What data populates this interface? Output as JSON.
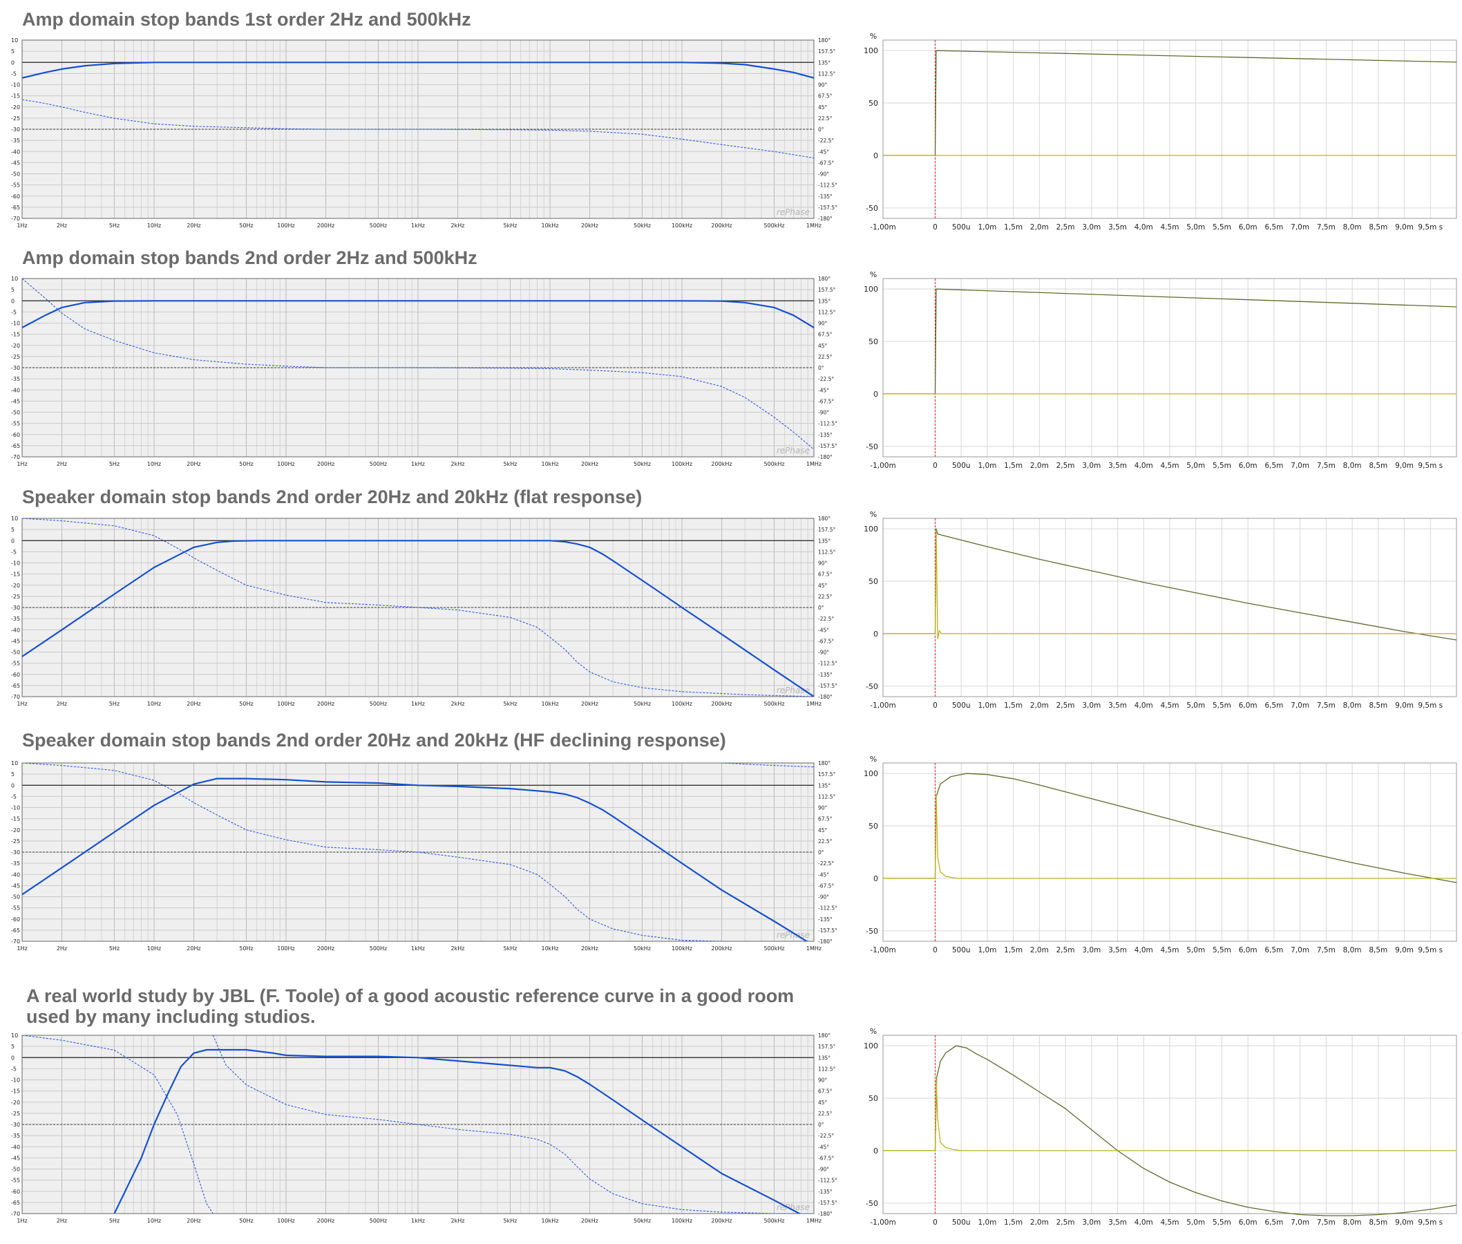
{
  "freq_axis": {
    "tick_labels": [
      "1Hz",
      "2Hz",
      "5Hz",
      "10Hz",
      "20Hz",
      "50Hz",
      "100Hz",
      "200Hz",
      "500Hz",
      "1kHz",
      "2kHz",
      "5kHz",
      "10kHz",
      "20kHz",
      "50kHz",
      "100kHz",
      "200kHz",
      "500kHz",
      "1MHz"
    ],
    "tick_values": [
      1,
      2,
      5,
      10,
      20,
      50,
      100,
      200,
      500,
      1000,
      2000,
      5000,
      10000,
      20000,
      50000,
      100000,
      200000,
      500000,
      1000000
    ],
    "xlim": [
      1,
      1000000
    ],
    "y_ticks": [
      "10",
      "5",
      "0",
      "-5",
      "-10",
      "-15",
      "-20",
      "-25",
      "-30",
      "-35",
      "-40",
      "-45",
      "-50",
      "-55",
      "-60",
      "-65",
      "-70"
    ],
    "phase_ticks": [
      "180°",
      "157.5°",
      "135°",
      "112.5°",
      "90°",
      "67.5°",
      "45°",
      "22.5°",
      "0°",
      "-22.5°",
      "-45°",
      "-67.5°",
      "-90°",
      "-112.5°",
      "-135°",
      "-157.5°",
      "-180°"
    ],
    "ylim": [
      -70,
      10
    ],
    "phase_lim": [
      -180,
      180
    ],
    "watermark": "rePhase"
  },
  "time_axis": {
    "tick_labels": [
      "-1,00m",
      "0",
      "500u",
      "1,0m",
      "1,5m",
      "2,0m",
      "2,5m",
      "3,0m",
      "3,5m",
      "4,0m",
      "4,5m",
      "5,0m",
      "5,5m",
      "6,0m",
      "6,5m",
      "7,0m",
      "7,5m",
      "8,0m",
      "8,5m",
      "9,0m",
      "9,5m s"
    ],
    "tick_values": [
      -1.0,
      0,
      0.5,
      1.0,
      1.5,
      2.0,
      2.5,
      3.0,
      3.5,
      4.0,
      4.5,
      5.0,
      5.5,
      6.0,
      6.5,
      7.0,
      7.5,
      8.0,
      8.5,
      9.0,
      9.5
    ],
    "xlim": [
      -1.0,
      10.0
    ],
    "y_ticks": [
      "100",
      "50",
      "0",
      "-50"
    ],
    "y_values": [
      100,
      50,
      0,
      -50
    ],
    "ylim": [
      -60,
      110
    ],
    "y_unit": "%"
  },
  "colors": {
    "magnitude": "#1550d0",
    "phase": "#2a5ad8",
    "step": "#5e6a2c",
    "impulse": "#bfb21a",
    "marker": "#dd2222"
  },
  "chart_data": [
    {
      "id": "p1",
      "type": "line",
      "title": "Amp domain stop bands 1st order 2Hz and 500kHz",
      "series": [
        {
          "name": "",
          "style": "magnitude",
          "x": [
            1,
            1.5,
            2,
            3,
            5,
            10,
            100,
            1000,
            10000,
            100000,
            200000,
            300000,
            500000,
            700000,
            1000000
          ],
          "y": [
            -7,
            -4.5,
            -3,
            -1.5,
            -0.5,
            0,
            0,
            0,
            0,
            0,
            -0.4,
            -1,
            -3,
            -4.5,
            -7
          ]
        },
        {
          "name": "",
          "style": "phase",
          "x": [
            1,
            1.5,
            2,
            3,
            5,
            10,
            20,
            50,
            100,
            200,
            1000,
            5000,
            10000,
            20000,
            50000,
            100000,
            200000,
            500000,
            1000000
          ],
          "y": [
            60,
            52,
            45,
            34,
            22,
            11,
            6,
            3,
            1,
            0,
            0,
            -1,
            -2,
            -4,
            -10,
            -20,
            -31,
            -45,
            -58
          ]
        }
      ]
    },
    {
      "id": "p2",
      "type": "line",
      "title": "Amp domain stop bands 2nd order 2Hz and 500kHz",
      "series": [
        {
          "name": "",
          "style": "magnitude",
          "x": [
            1,
            1.5,
            2,
            3,
            5,
            10,
            100,
            10000,
            100000,
            200000,
            300000,
            500000,
            700000,
            1000000
          ],
          "y": [
            -12,
            -6.5,
            -3,
            -0.8,
            -0.1,
            0,
            0,
            0,
            0,
            -0.1,
            -0.8,
            -3,
            -6.5,
            -12
          ]
        },
        {
          "name": "",
          "style": "phase",
          "x": [
            1,
            1.5,
            2,
            3,
            5,
            10,
            20,
            50,
            100,
            200,
            1000,
            5000,
            10000,
            20000,
            50000,
            100000,
            200000,
            300000,
            500000,
            700000,
            1000000
          ],
          "y": [
            180,
            140,
            110,
            78,
            55,
            30,
            16,
            7,
            3,
            0,
            0,
            -1,
            -2,
            -5,
            -10,
            -18,
            -38,
            -60,
            -100,
            -130,
            -165
          ]
        }
      ]
    },
    {
      "id": "p3",
      "type": "line",
      "title": "Speaker domain stop bands 2nd order 20Hz and 20kHz (flat response)",
      "series": [
        {
          "name": "",
          "style": "magnitude",
          "x": [
            1,
            2,
            5,
            10,
            20,
            30,
            40,
            60,
            100,
            1000,
            10000,
            13000,
            16000,
            20000,
            25000,
            30000,
            40000,
            60000,
            100000,
            200000,
            500000,
            1000000
          ],
          "y": [
            -52,
            -40,
            -24,
            -12,
            -3,
            -0.8,
            -0.2,
            0,
            0,
            0,
            0,
            -0.5,
            -1.5,
            -3,
            -6,
            -9,
            -14,
            -21,
            -30,
            -42,
            -58,
            -70
          ]
        },
        {
          "name": "",
          "style": "phase",
          "x": [
            1,
            2,
            5,
            10,
            15,
            20,
            30,
            50,
            100,
            200,
            500,
            1000,
            2000,
            5000,
            8000,
            10000,
            13000,
            16000,
            20000,
            30000,
            50000,
            100000,
            300000,
            1000000
          ],
          "y": [
            180,
            175,
            165,
            145,
            120,
            100,
            75,
            45,
            25,
            10,
            5,
            0,
            -5,
            -20,
            -40,
            -60,
            -85,
            -110,
            -130,
            -150,
            -162,
            -170,
            -176,
            -180
          ]
        }
      ]
    },
    {
      "id": "p4",
      "type": "line",
      "title": "Speaker domain stop bands 2nd order 20Hz and 20kHz (HF declining response)",
      "series": [
        {
          "name": "",
          "style": "magnitude",
          "x": [
            1,
            2,
            5,
            10,
            20,
            30,
            50,
            100,
            200,
            500,
            1000,
            2000,
            5000,
            10000,
            13000,
            16000,
            20000,
            25000,
            30000,
            40000,
            60000,
            100000,
            200000,
            500000,
            1000000
          ],
          "y": [
            -49,
            -37,
            -21,
            -9,
            0.5,
            3,
            3,
            2.5,
            1.5,
            1,
            0,
            -0.5,
            -1.5,
            -3,
            -4,
            -5.5,
            -8,
            -11,
            -14,
            -19,
            -26,
            -35,
            -47,
            -61,
            -72
          ]
        },
        {
          "name": "",
          "style": "phase",
          "x": [
            1,
            2,
            5,
            10,
            15,
            20,
            30,
            50,
            100,
            200,
            500,
            1000,
            2000,
            5000,
            8000,
            10000,
            13000,
            16000,
            20000,
            30000,
            50000,
            100000,
            200000
          ],
          "y": [
            180,
            175,
            165,
            145,
            120,
            100,
            75,
            45,
            25,
            10,
            5,
            0,
            -10,
            -25,
            -45,
            -65,
            -90,
            -115,
            -135,
            -155,
            -168,
            -178,
            -180
          ]
        },
        {
          "name": "",
          "style": "phase",
          "x": [
            200000,
            500000,
            1000000
          ],
          "y": [
            180,
            175,
            172
          ]
        }
      ]
    },
    {
      "id": "p5",
      "type": "line",
      "title": "A real world study by JBL (F. Toole) of a good acoustic reference curve in a good room\nused by many including studios.",
      "series": [
        {
          "name": "",
          "style": "magnitude",
          "x": [
            5,
            8,
            10,
            13,
            16,
            20,
            25,
            30,
            50,
            80,
            100,
            200,
            500,
            1000,
            2000,
            5000,
            8000,
            10000,
            13000,
            16000,
            20000,
            30000,
            50000,
            100000,
            200000,
            500000,
            900000
          ],
          "y": [
            -70,
            -45,
            -30,
            -15,
            -4,
            2,
            3.5,
            3.5,
            3.5,
            2,
            1,
            0.5,
            0.5,
            0,
            -1.5,
            -3.5,
            -4.5,
            -4.5,
            -6,
            -8.5,
            -12,
            -19,
            -28,
            -40,
            -52,
            -64,
            -72
          ]
        },
        {
          "name": "",
          "style": "phase",
          "x": [
            1,
            2,
            5,
            10,
            15,
            20,
            25,
            28
          ],
          "y": [
            180,
            170,
            150,
            100,
            20,
            -80,
            -160,
            -180
          ]
        },
        {
          "name": "",
          "style": "phase",
          "x": [
            28,
            35,
            50,
            100,
            200,
            500,
            1000,
            2000,
            5000,
            8000,
            10000,
            13000,
            16000,
            20000,
            30000,
            50000,
            100000,
            200000,
            500000,
            1000000
          ],
          "y": [
            180,
            120,
            80,
            40,
            20,
            10,
            0,
            -10,
            -20,
            -30,
            -40,
            -60,
            -85,
            -110,
            -140,
            -160,
            -172,
            -177,
            -180,
            -180
          ]
        }
      ],
      "step": "toole"
    }
  ],
  "step_data": [
    {
      "id": "s1",
      "type": "line",
      "series": [
        {
          "name": "",
          "style": "step",
          "x": [
            -1.0,
            -0.03,
            0,
            0.02,
            10.0
          ],
          "y": [
            0,
            0,
            0,
            100,
            89
          ]
        },
        {
          "name": "",
          "style": "impulse",
          "x": [
            -1.0,
            0,
            10.0
          ],
          "y": [
            0,
            0,
            0
          ]
        }
      ]
    },
    {
      "id": "s2",
      "type": "line",
      "series": [
        {
          "name": "",
          "style": "step",
          "x": [
            -1.0,
            -0.03,
            0,
            0.02,
            10.0
          ],
          "y": [
            0,
            0,
            0,
            100,
            83
          ]
        },
        {
          "name": "",
          "style": "impulse",
          "x": [
            -1.0,
            0,
            10.0
          ],
          "y": [
            0,
            0,
            0
          ]
        }
      ]
    },
    {
      "id": "s3",
      "type": "line",
      "series": [
        {
          "name": "",
          "style": "step",
          "x": [
            -1.0,
            -0.03,
            0,
            0.02,
            0.05,
            1.0,
            2.0,
            3.0,
            4.0,
            5.0,
            6.0,
            7.0,
            8.0,
            9.0,
            10.0
          ],
          "y": [
            0,
            0,
            0,
            100,
            95,
            83,
            71,
            60,
            49,
            39,
            29,
            20,
            11,
            2,
            -6
          ]
        },
        {
          "name": "",
          "style": "impulse",
          "x": [
            -1.0,
            0,
            0.02,
            0.05,
            0.08,
            0.12,
            10.0
          ],
          "y": [
            0,
            0,
            98,
            -5,
            3,
            0,
            0
          ]
        }
      ]
    },
    {
      "id": "s4",
      "type": "line",
      "series": [
        {
          "name": "",
          "style": "step",
          "x": [
            -1.0,
            -0.03,
            0,
            0.02,
            0.1,
            0.3,
            0.6,
            1.0,
            1.5,
            2.0,
            3.0,
            4.0,
            5.0,
            6.0,
            7.0,
            8.0,
            9.0,
            10.0
          ],
          "y": [
            0,
            0,
            0,
            78,
            90,
            97,
            100,
            99,
            95,
            89,
            76,
            63,
            50,
            38,
            26,
            15,
            5,
            -4
          ]
        },
        {
          "name": "",
          "style": "impulse",
          "x": [
            -1.0,
            0,
            0.02,
            0.05,
            0.1,
            0.2,
            0.4,
            10.0
          ],
          "y": [
            0,
            0,
            80,
            20,
            6,
            2,
            0,
            0
          ]
        }
      ]
    },
    {
      "id": "s5",
      "type": "line",
      "series": [
        {
          "name": "",
          "style": "step",
          "x": [
            -1.0,
            -0.03,
            0,
            0.03,
            0.1,
            0.2,
            0.4,
            0.6,
            0.8,
            1.0,
            1.5,
            2.0,
            2.5,
            3.0,
            3.5,
            4.0,
            4.5,
            5.0,
            5.5,
            6.0,
            6.5,
            7.0,
            7.5,
            8.0,
            8.5,
            9.0,
            9.5,
            10.0
          ],
          "y": [
            0,
            0,
            0,
            70,
            85,
            93,
            100,
            98,
            92,
            87,
            72,
            56,
            40,
            20,
            0,
            -17,
            -30,
            -40,
            -48,
            -54,
            -58,
            -61,
            -62,
            -62,
            -61,
            -59,
            -56,
            -52
          ]
        },
        {
          "name": "",
          "style": "impulse",
          "x": [
            -1.0,
            0,
            0.02,
            0.05,
            0.1,
            0.2,
            0.35,
            0.5,
            10.0
          ],
          "y": [
            0,
            0,
            68,
            30,
            8,
            3,
            1,
            0,
            0
          ]
        }
      ]
    }
  ]
}
